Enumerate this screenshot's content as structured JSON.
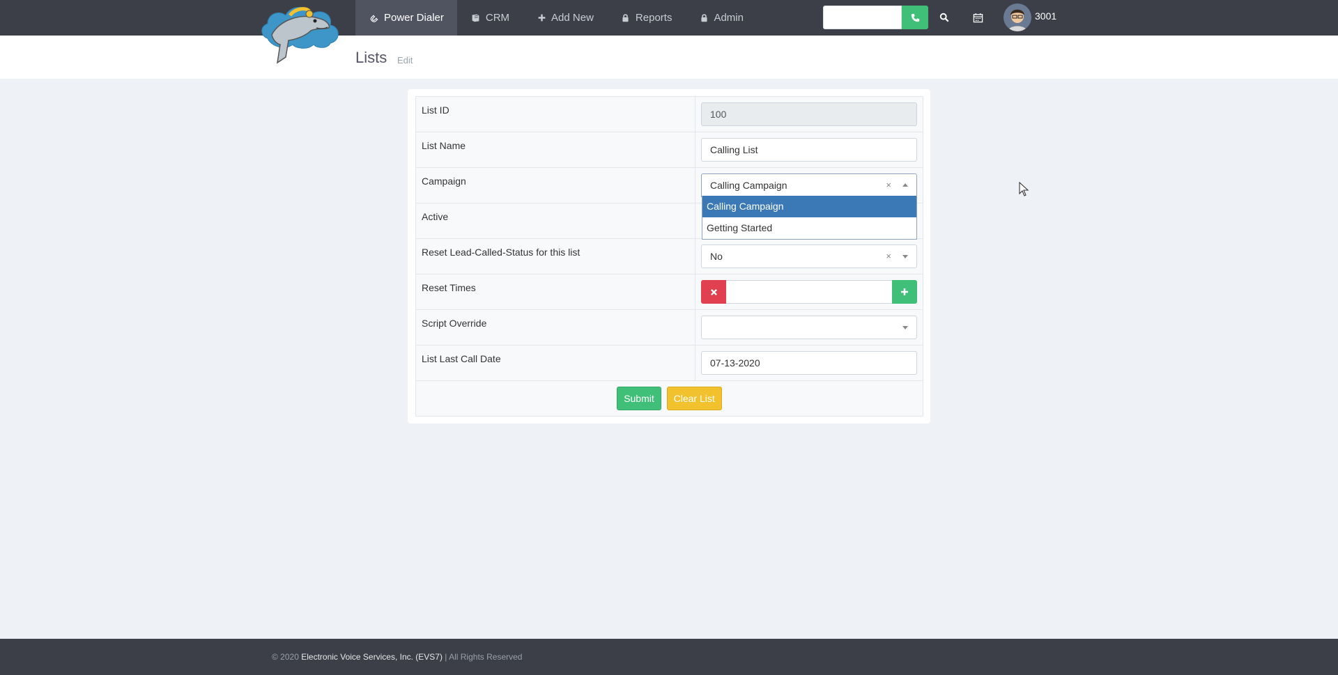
{
  "nav": {
    "items": [
      {
        "label": "Power Dialer",
        "icon": "phone-link-icon",
        "active": true
      },
      {
        "label": "CRM",
        "icon": "book-icon",
        "active": false
      },
      {
        "label": "Add New",
        "icon": "plus-icon",
        "active": false
      },
      {
        "label": "Reports",
        "icon": "lock-icon",
        "active": false
      },
      {
        "label": "Admin",
        "icon": "lock-icon",
        "active": false
      }
    ],
    "dial_placeholder": "",
    "user_id": "3001"
  },
  "page": {
    "title": "Lists",
    "subtitle": "Edit"
  },
  "form": {
    "fields": {
      "list_id": {
        "label": "List ID",
        "value": "100"
      },
      "list_name": {
        "label": "List Name",
        "value": "Calling List"
      },
      "campaign": {
        "label": "Campaign",
        "value": "Calling Campaign",
        "options": [
          "Calling Campaign",
          "Getting Started"
        ],
        "highlighted": "Calling Campaign"
      },
      "active": {
        "label": "Active"
      },
      "reset_status": {
        "label": "Reset Lead-Called-Status for this list",
        "value": "No"
      },
      "reset_times": {
        "label": "Reset Times",
        "value": ""
      },
      "script_override": {
        "label": "Script Override",
        "value": ""
      },
      "last_call_date": {
        "label": "List Last Call Date",
        "value": "07-13-2020"
      }
    },
    "clear_glyph": "×",
    "submit_label": "Submit",
    "clear_label": "Clear List"
  },
  "footer": {
    "prefix": "© 2020 ",
    "company": "Electronic Voice Services, Inc. (EVS7)",
    "suffix": " | All Rights Reserved"
  },
  "colors": {
    "topbar": "#3c3f48",
    "accent_green": "#3fbf78",
    "danger_red": "#e0404f",
    "warning_yellow": "#f2c12e",
    "dropdown_highlight": "#3b78b6"
  }
}
